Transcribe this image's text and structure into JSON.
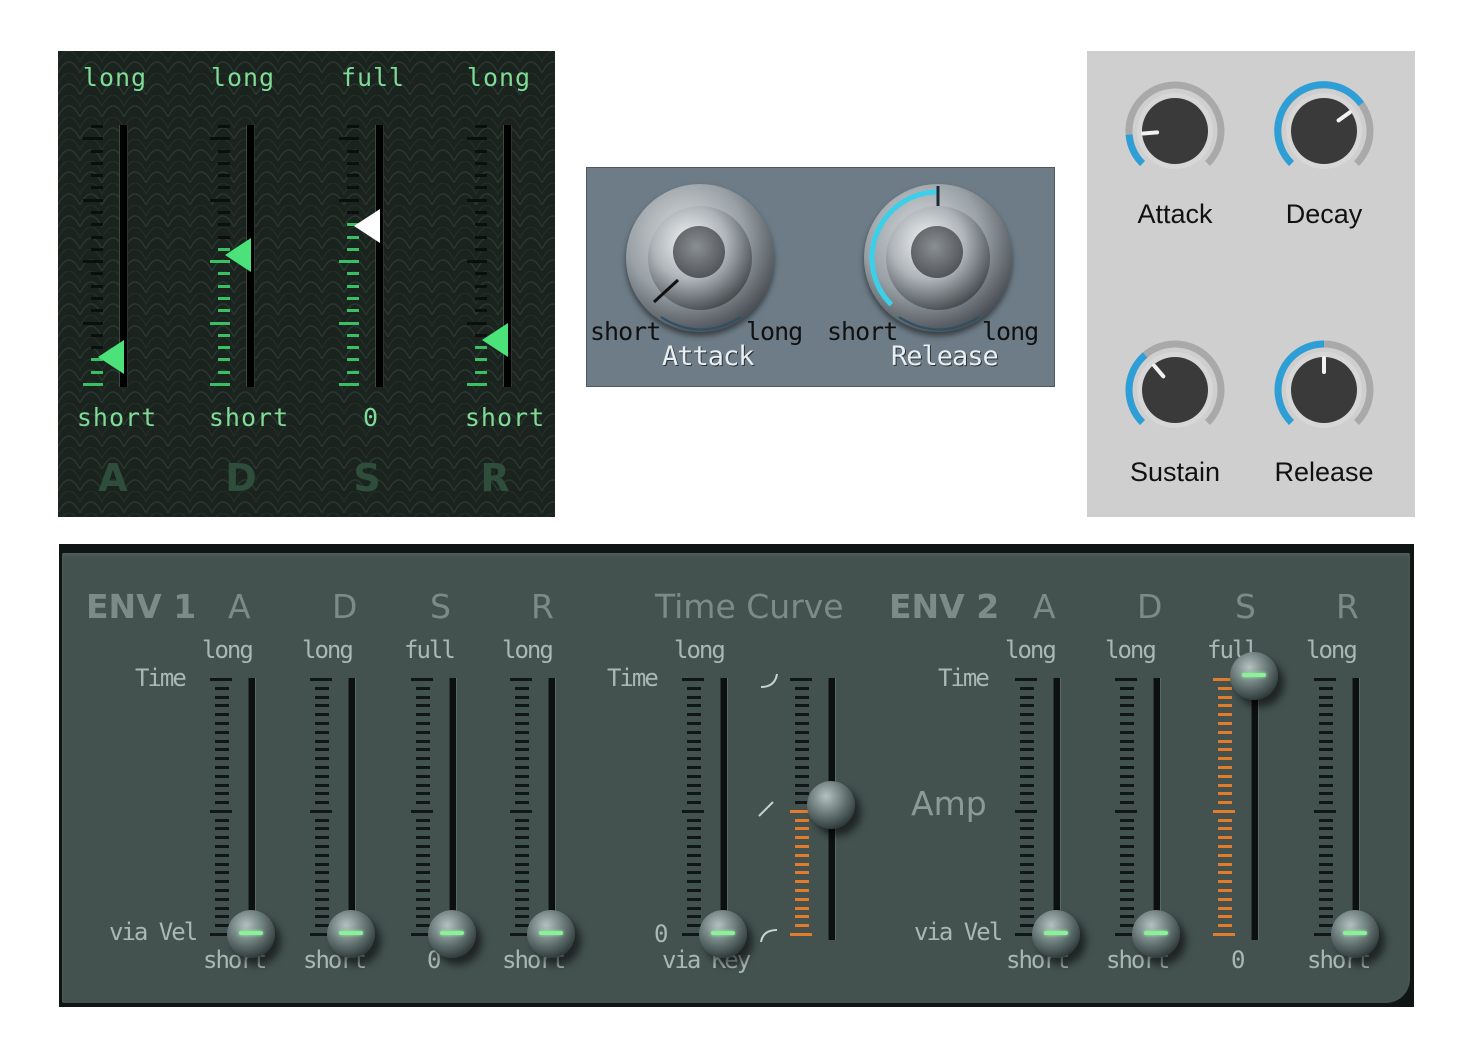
{
  "green_adsr": {
    "columns": [
      {
        "top_label": "long",
        "bottom_label": "short",
        "letter": "A",
        "level": 0.08
      },
      {
        "top_label": "long",
        "bottom_label": "short",
        "letter": "D",
        "level": 0.5
      },
      {
        "top_label": "full",
        "bottom_label": "0",
        "letter": "S",
        "level": 0.62
      },
      {
        "top_label": "long",
        "bottom_label": "short",
        "letter": "R",
        "level": 0.15
      }
    ],
    "colors": {
      "accent": "#3bbf64",
      "text": "#7fdc97",
      "background": "#1b231f"
    }
  },
  "steel_knobs": {
    "attack": {
      "name": "Attack",
      "min_label": "short",
      "max_label": "long",
      "value": 0.0
    },
    "release": {
      "name": "Release",
      "min_label": "short",
      "max_label": "long",
      "value": 0.5
    },
    "colors": {
      "arc": "#3ad0ea",
      "background": "#6d7c87"
    }
  },
  "flat_knobs": {
    "attack": {
      "label": "Attack",
      "value": 0.15
    },
    "decay": {
      "label": "Decay",
      "value": 0.7
    },
    "sustain": {
      "label": "Sustain",
      "value": 0.35
    },
    "release": {
      "label": "Release",
      "value": 0.5
    },
    "colors": {
      "arc": "#2d9fd6",
      "track": "#a9a9a9",
      "knob": "#3a3a3a",
      "background": "#cfcfcf"
    }
  },
  "env_panel": {
    "env1": {
      "title": "ENV 1",
      "time_label": "Time",
      "vel_label": "via Vel",
      "sliders": [
        {
          "letter": "A",
          "top_label": "long",
          "bottom_label": "short",
          "level": 0.0
        },
        {
          "letter": "D",
          "top_label": "long",
          "bottom_label": "short",
          "level": 0.0
        },
        {
          "letter": "S",
          "top_label": "full",
          "bottom_label": "0",
          "level": 0.0
        },
        {
          "letter": "R",
          "top_label": "long",
          "bottom_label": "short",
          "level": 0.0
        }
      ]
    },
    "time_curve": {
      "title": "Time Curve",
      "time_label": "Time",
      "zero_label": "0",
      "top_label": "long",
      "bottom_label": "via Key",
      "curve_level": 0.5
    },
    "env2": {
      "title": "ENV 2",
      "time_label": "Time",
      "amp_label": "Amp",
      "vel_label": "via Vel",
      "sliders": [
        {
          "letter": "A",
          "top_label": "long",
          "bottom_label": "short",
          "level": 0.0
        },
        {
          "letter": "D",
          "top_label": "long",
          "bottom_label": "short",
          "level": 0.0
        },
        {
          "letter": "S",
          "top_label": "full",
          "bottom_label": "0",
          "level": 1.0
        },
        {
          "letter": "R",
          "top_label": "long",
          "bottom_label": "short",
          "level": 0.0
        }
      ]
    },
    "colors": {
      "face": "#43524f",
      "text": "#aab7b3",
      "led": "#8cf09a",
      "scale_lit": "#e07c2c"
    }
  }
}
